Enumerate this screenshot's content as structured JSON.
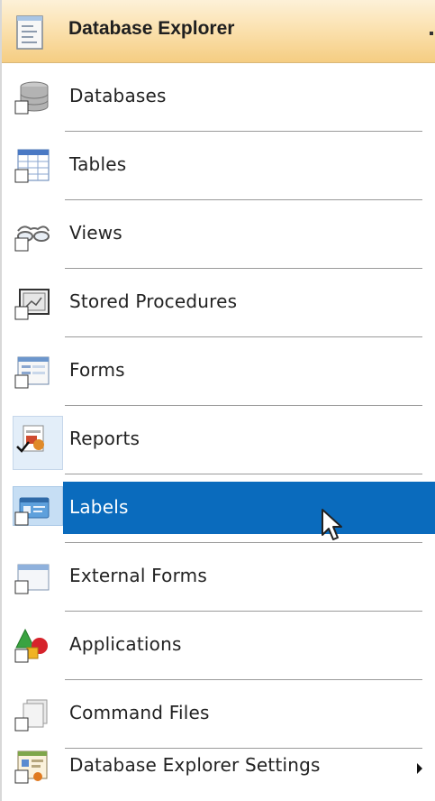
{
  "header": {
    "title": "Database Explorer",
    "icon": "document-list-icon"
  },
  "menu": {
    "items": [
      {
        "label": "Databases",
        "icon": "database-stack-icon"
      },
      {
        "label": "Tables",
        "icon": "table-grid-icon"
      },
      {
        "label": "Views",
        "icon": "glasses-icon"
      },
      {
        "label": "Stored Procedures",
        "icon": "monitor-window-icon"
      },
      {
        "label": "Forms",
        "icon": "form-window-icon"
      },
      {
        "label": "Reports",
        "icon": "report-icon",
        "checked": true
      },
      {
        "label": "Labels",
        "icon": "label-card-icon",
        "selected": true
      },
      {
        "label": "External Forms",
        "icon": "external-form-icon"
      },
      {
        "label": "Applications",
        "icon": "shapes-icon"
      },
      {
        "label": "Command Files",
        "icon": "files-stack-icon"
      },
      {
        "label": "Database Explorer Settings",
        "icon": "settings-window-icon",
        "has_submenu": true
      }
    ]
  },
  "colors": {
    "header_gradient_top": "#fdf1d8",
    "header_gradient_bottom": "#f5cd82",
    "selection": "#0a6bbd",
    "divider": "#9a9a9a"
  }
}
